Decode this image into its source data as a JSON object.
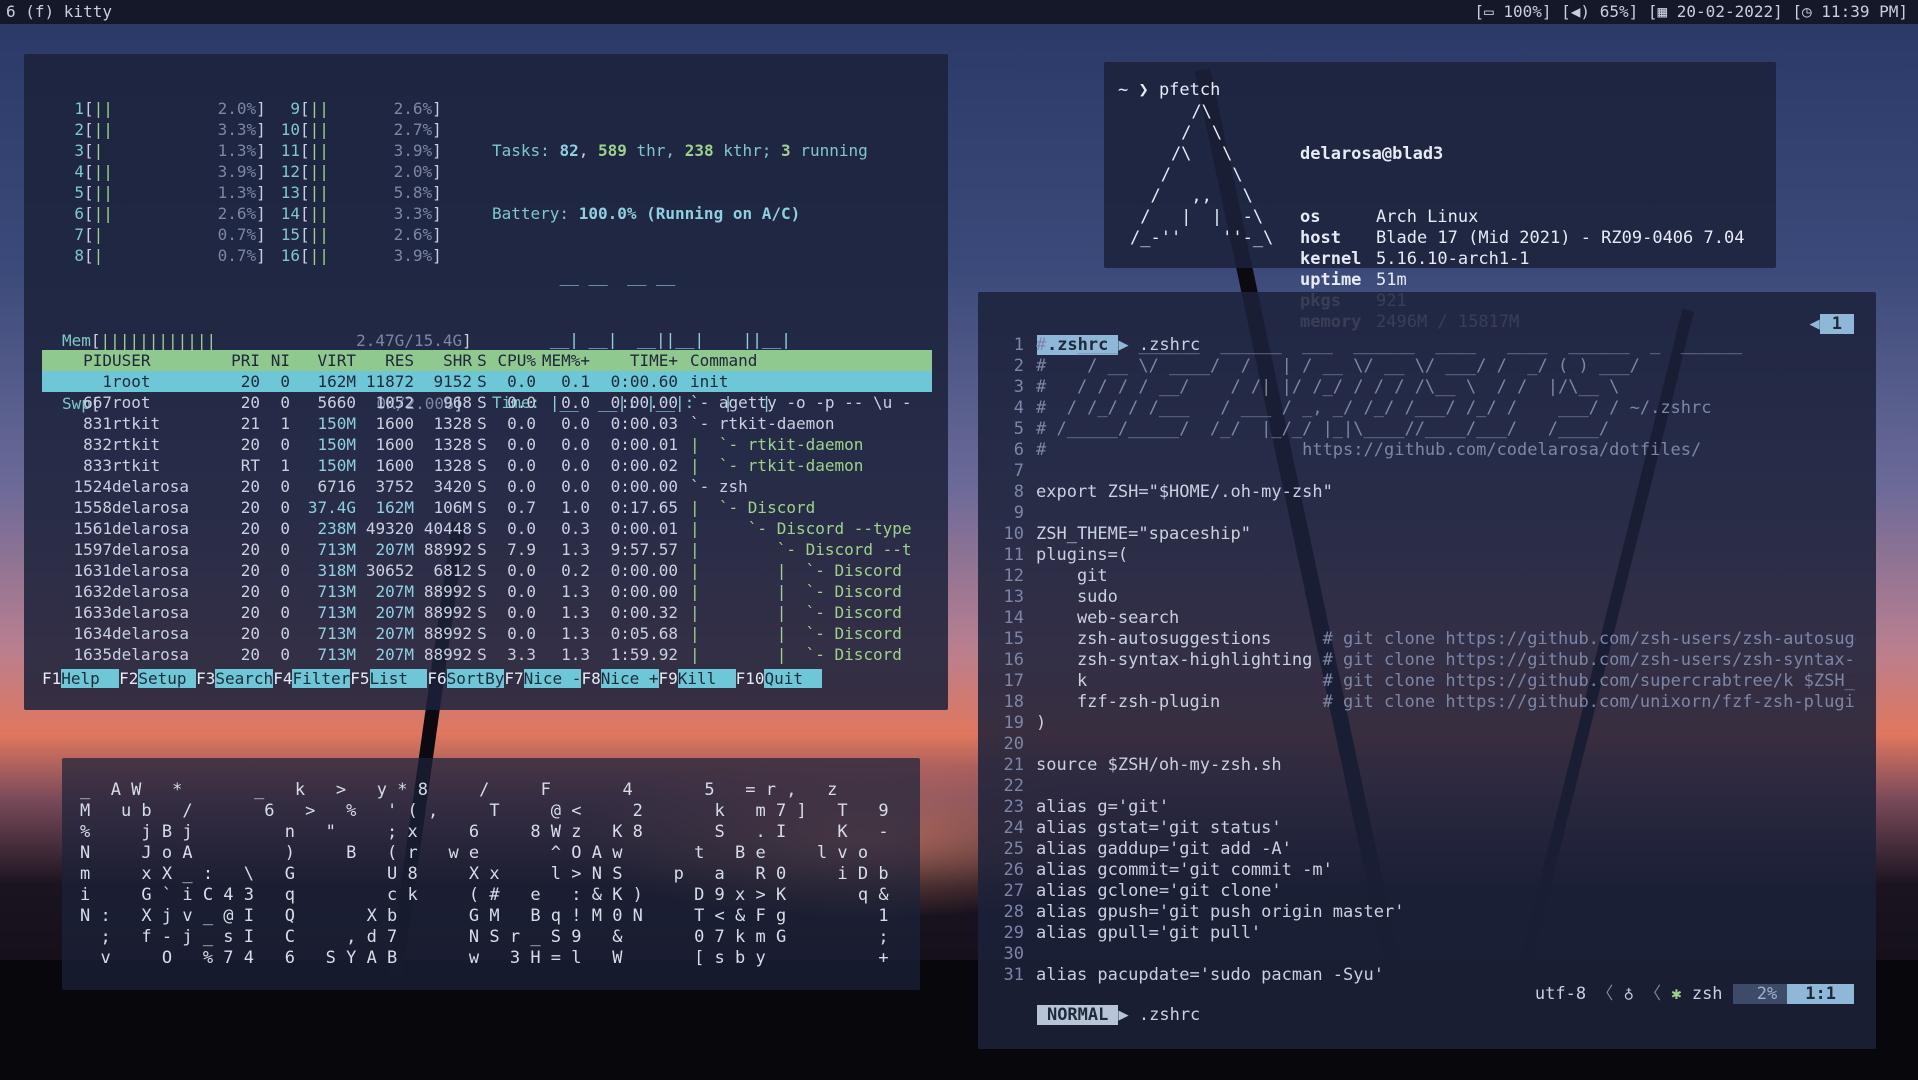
{
  "topbar": {
    "workspace": "6 (f) kitty",
    "battery": "100%",
    "volume": "65%",
    "date": "20-02-2022",
    "time": "11:39 PM"
  },
  "htop": {
    "cpus": [
      {
        "n": "1",
        "bar": "||",
        "pct": "2.0%"
      },
      {
        "n": "2",
        "bar": "||",
        "pct": "3.3%"
      },
      {
        "n": "3",
        "bar": "|",
        "pct": "1.3%"
      },
      {
        "n": "4",
        "bar": "||",
        "pct": "3.9%"
      },
      {
        "n": "5",
        "bar": "||",
        "pct": "1.3%"
      },
      {
        "n": "6",
        "bar": "||",
        "pct": "2.6%"
      },
      {
        "n": "7",
        "bar": "|",
        "pct": "0.7%"
      },
      {
        "n": "8",
        "bar": "|",
        "pct": "0.7%"
      },
      {
        "n": "9",
        "bar": "||",
        "pct": "2.6%"
      },
      {
        "n": "10",
        "bar": "||",
        "pct": "2.7%"
      },
      {
        "n": "11",
        "bar": "||",
        "pct": "3.9%"
      },
      {
        "n": "12",
        "bar": "||",
        "pct": "2.0%"
      },
      {
        "n": "13",
        "bar": "||",
        "pct": "5.8%"
      },
      {
        "n": "14",
        "bar": "||",
        "pct": "3.3%"
      },
      {
        "n": "15",
        "bar": "||",
        "pct": "2.6%"
      },
      {
        "n": "16",
        "bar": "||",
        "pct": "3.9%"
      }
    ],
    "tasks_label": "Tasks:",
    "tasks_count": "82",
    "threads": "589",
    "threads_label": "thr,",
    "kthreads": "238",
    "kthreads_label": "kthr;",
    "running": "3",
    "running_label": "running",
    "battery_label": "Battery:",
    "battery_value": "100.0% (Running on A/C)",
    "time_label": "Time:",
    "time_art": [
      " __ __  __ __",
      "__| __|  __||__|    ||__|",
      "|__  __|: |__|:   |   |"
    ],
    "mem_label": "Mem",
    "mem_bar": "||||||||||||",
    "mem_value": "2.47G/15.4G",
    "swp_label": "Swp",
    "swp_value": "0K/2.00G",
    "columns": [
      "PID",
      "USER",
      "PRI",
      "NI",
      "VIRT",
      "RES",
      "SHR",
      "S",
      "CPU%",
      "MEM%+",
      "TIME+",
      "Command"
    ],
    "rows": [
      [
        "1",
        "root",
        "20",
        "0",
        "162M",
        "11872",
        "9152",
        "S",
        "0.0",
        "0.1",
        "0:00.60",
        "init"
      ],
      [
        "667",
        "root",
        "20",
        "0",
        "5660",
        "1052",
        "968",
        "S",
        "0.0",
        "0.0",
        "0:00.00",
        "`- agetty -o -p -- \\u -"
      ],
      [
        "831",
        "rtkit",
        "21",
        "1",
        "150M",
        "1600",
        "1328",
        "S",
        "0.0",
        "0.0",
        "0:00.03",
        "`- rtkit-daemon"
      ],
      [
        "832",
        "rtkit",
        "20",
        "0",
        "150M",
        "1600",
        "1328",
        "S",
        "0.0",
        "0.0",
        "0:00.01",
        "|  `- rtkit-daemon"
      ],
      [
        "833",
        "rtkit",
        "RT",
        "1",
        "150M",
        "1600",
        "1328",
        "S",
        "0.0",
        "0.0",
        "0:00.02",
        "|  `- rtkit-daemon"
      ],
      [
        "1524",
        "delarosa",
        "20",
        "0",
        "6716",
        "3752",
        "3420",
        "S",
        "0.0",
        "0.0",
        "0:00.00",
        "`- zsh"
      ],
      [
        "1558",
        "delarosa",
        "20",
        "0",
        "37.4G",
        "162M",
        "106M",
        "S",
        "0.7",
        "1.0",
        "0:17.65",
        "|  `- Discord"
      ],
      [
        "1561",
        "delarosa",
        "20",
        "0",
        "238M",
        "49320",
        "40448",
        "S",
        "0.0",
        "0.3",
        "0:00.01",
        "|     `- Discord --type"
      ],
      [
        "1597",
        "delarosa",
        "20",
        "0",
        "713M",
        "207M",
        "88992",
        "S",
        "7.9",
        "1.3",
        "9:57.57",
        "|        `- Discord --t"
      ],
      [
        "1631",
        "delarosa",
        "20",
        "0",
        "318M",
        "30652",
        "6812",
        "S",
        "0.0",
        "0.2",
        "0:00.00",
        "|        |  `- Discord"
      ],
      [
        "1632",
        "delarosa",
        "20",
        "0",
        "713M",
        "207M",
        "88992",
        "S",
        "0.0",
        "1.3",
        "0:00.00",
        "|        |  `- Discord"
      ],
      [
        "1633",
        "delarosa",
        "20",
        "0",
        "713M",
        "207M",
        "88992",
        "S",
        "0.0",
        "1.3",
        "0:00.32",
        "|        |  `- Discord"
      ],
      [
        "1634",
        "delarosa",
        "20",
        "0",
        "713M",
        "207M",
        "88992",
        "S",
        "0.0",
        "1.3",
        "0:05.68",
        "|        |  `- Discord"
      ],
      [
        "1635",
        "delarosa",
        "20",
        "0",
        "713M",
        "207M",
        "88992",
        "S",
        "3.3",
        "1.3",
        "1:59.92",
        "|        |  `- Discord"
      ]
    ],
    "fkeys": [
      {
        "k": "F1",
        "l": "Help  "
      },
      {
        "k": "F2",
        "l": "Setup "
      },
      {
        "k": "F3",
        "l": "Search"
      },
      {
        "k": "F4",
        "l": "Filter"
      },
      {
        "k": "F5",
        "l": "List  "
      },
      {
        "k": "F6",
        "l": "SortBy"
      },
      {
        "k": "F7",
        "l": "Nice -"
      },
      {
        "k": "F8",
        "l": "Nice +"
      },
      {
        "k": "F9",
        "l": "Kill  "
      },
      {
        "k": "F10",
        "l": "Quit  "
      }
    ]
  },
  "pfetch": {
    "prompt": "~ ❯ pfetch",
    "logo": [
      "      /\\",
      "     /  \\",
      "    /\\   \\",
      "   /      \\",
      "  /   ,,   \\",
      " /   |  |  -\\",
      "/_-''    ''-_\\"
    ],
    "user": "delarosa@blad3",
    "fields": [
      {
        "k": "os",
        "v": "Arch Linux"
      },
      {
        "k": "host",
        "v": "Blade 17 (Mid 2021) - RZ09-0406 7.04"
      },
      {
        "k": "kernel",
        "v": "5.16.10-arch1-1"
      },
      {
        "k": "uptime",
        "v": "51m"
      },
      {
        "k": "pkgs",
        "v": "921"
      },
      {
        "k": "memory",
        "v": "2496M / 15817M"
      }
    ]
  },
  "matrix": {
    "lines": [
      "_  A W   *       _   k   >   y * 8     /     F       4       5   = r ,   z",
      "M   u b   /       6   >   %   ' ( ,     T     @ <     2       k   m 7 ]   T   9",
      "%     j B j         n   \"     ; x     6     8 W z   K 8       S   . I     K   -",
      "N     J o A         )     B   ( r   w e       ^ O A w       t   B e     l v o",
      "m     x X _ :   \\   G         U 8     X x     l > N S     p   a   R 0     i D b",
      "i     G ` i C 4 3   q         c k     ( #   e   : & K )     D 9 x > K       q &",
      "N :   X j v _ @ I   Q       X b       G M   B q ! M 0 N     T < & F g         1",
      "  ;   f - j _ s I   C     , d 7       N S r _ S 9   &       0 7 k m G         ;",
      "  v     O   % 7 4   6   S Y A B       w   3 H = l   W       [ s b y           +"
    ]
  },
  "vim": {
    "tab_active": ".zshrc",
    "tab_name": ".zshrc",
    "buffer_num": "1",
    "lines": [
      {
        "n": "1",
        "t": "#   ____  ______  ______  ___  ______  ____   ____  ______  _  ______",
        "c": "dim"
      },
      {
        "n": "2",
        "t": "#    / __ \\/ ____/  /   | / __ \\/ __ \\/ ___/ /  _/ ( ) ___/",
        "c": "dim"
      },
      {
        "n": "3",
        "t": "#   / / / / __/    / /| |/ /_/ / / / /\\__ \\  / /  |/\\__ \\",
        "c": "dim"
      },
      {
        "n": "4",
        "t": "#  / /_/ / /___   / ___ / _, _/ /_/ /___/ /_/ /    ___/ / ~/.zshrc",
        "c": "dim"
      },
      {
        "n": "5",
        "t": "# /_____/_____/  /_/  |_/_/ |_|\\____//____/___/   /____/",
        "c": "dim"
      },
      {
        "n": "6",
        "t": "#                         https://github.com/codelarosa/dotfiles/",
        "c": "dim"
      },
      {
        "n": "7",
        "t": "",
        "c": ""
      },
      {
        "n": "8",
        "t": "export ZSH=\"$HOME/.oh-my-zsh\"",
        "c": ""
      },
      {
        "n": "9",
        "t": "",
        "c": ""
      },
      {
        "n": "10",
        "t": "ZSH_THEME=\"spaceship\"",
        "c": ""
      },
      {
        "n": "11",
        "t": "plugins=(",
        "c": ""
      },
      {
        "n": "12",
        "t": "    git",
        "c": ""
      },
      {
        "n": "13",
        "t": "    sudo",
        "c": ""
      },
      {
        "n": "14",
        "t": "    web-search",
        "c": ""
      },
      {
        "n": "15",
        "t": "    zsh-autosuggestions     # git clone https://github.com/zsh-users/zsh-autosugge",
        "c": ""
      },
      {
        "n": "16",
        "t": "    zsh-syntax-highlighting # git clone https://github.com/zsh-users/zsh-syntax-hi",
        "c": ""
      },
      {
        "n": "17",
        "t": "    k                       # git clone https://github.com/supercrabtree/k $ZSH_CU",
        "c": ""
      },
      {
        "n": "18",
        "t": "    fzf-zsh-plugin          # git clone https://github.com/unixorn/fzf-zsh-plugin.",
        "c": ""
      },
      {
        "n": "19",
        "t": ")",
        "c": ""
      },
      {
        "n": "20",
        "t": "",
        "c": ""
      },
      {
        "n": "21",
        "t": "source $ZSH/oh-my-zsh.sh",
        "c": ""
      },
      {
        "n": "22",
        "t": "",
        "c": ""
      },
      {
        "n": "23",
        "t": "alias g='git'",
        "c": ""
      },
      {
        "n": "24",
        "t": "alias gstat='git status'",
        "c": ""
      },
      {
        "n": "25",
        "t": "alias gaddup='git add -A'",
        "c": ""
      },
      {
        "n": "26",
        "t": "alias gcommit='git commit -m'",
        "c": ""
      },
      {
        "n": "27",
        "t": "alias gclone='git clone'",
        "c": ""
      },
      {
        "n": "28",
        "t": "alias gpush='git push origin master'",
        "c": ""
      },
      {
        "n": "29",
        "t": "alias gpull='git pull'",
        "c": ""
      },
      {
        "n": "30",
        "t": "",
        "c": ""
      },
      {
        "n": "31",
        "t": "alias pacupdate='sudo pacman -Syu'",
        "c": ""
      }
    ],
    "status": {
      "mode": "NORMAL",
      "file": ".zshrc",
      "encoding": "utf-8",
      "filetype": "zsh",
      "percent": "2%",
      "position": "1:1"
    }
  }
}
